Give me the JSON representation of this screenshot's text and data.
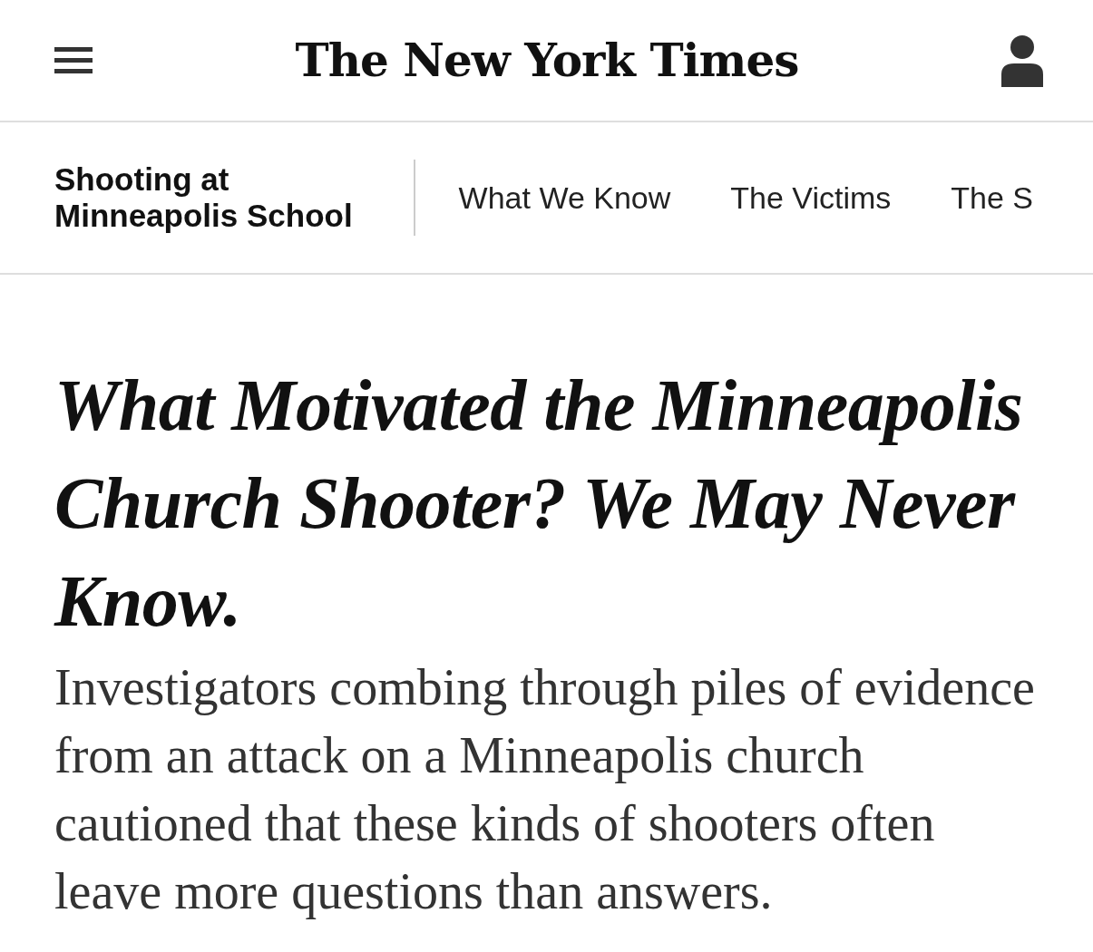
{
  "header": {
    "logo": "The New York Times"
  },
  "section_nav": {
    "label": "Shooting at Minneapolis School",
    "items": [
      "What We Know",
      "The Victims",
      "The S"
    ]
  },
  "article": {
    "headline": "What Motivated the Minneapolis Church Shooter? We May Never Know.",
    "summary": "Investigators combing through piles of evidence from an attack on a Minneapolis church cautioned that these kinds of shooters often leave more questions than answers."
  }
}
